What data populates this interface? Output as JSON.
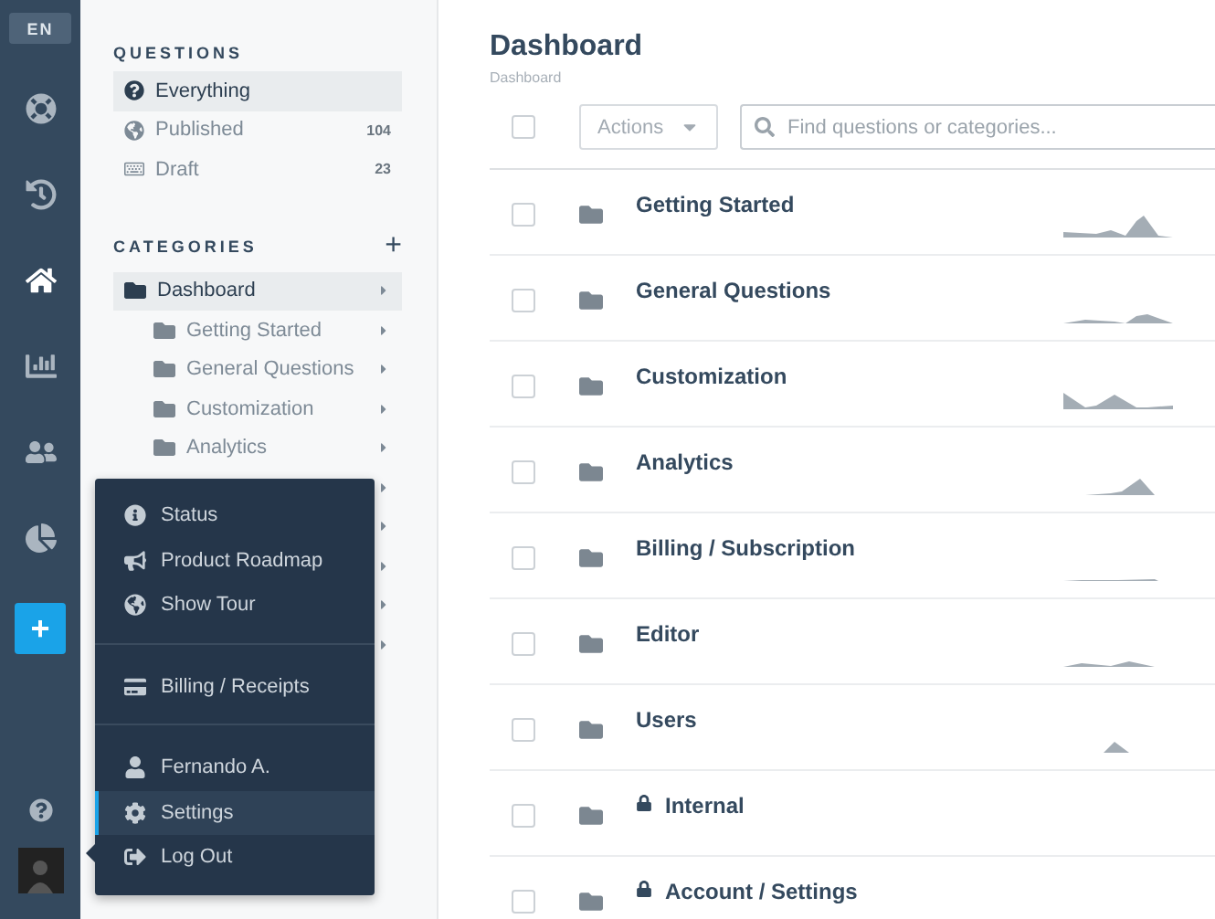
{
  "rail": {
    "language": "EN",
    "items": [
      {
        "selected": false
      },
      {
        "selected": false
      },
      {
        "selected": true
      },
      {
        "selected": false
      },
      {
        "selected": false
      },
      {
        "selected": false
      }
    ],
    "add_button": "+"
  },
  "sidebar": {
    "questions_heading": "QUESTIONS",
    "questions": [
      {
        "label": "Everything",
        "selected": true
      },
      {
        "label": "Published",
        "count": "104",
        "selected": false
      },
      {
        "label": "Draft",
        "count": "23",
        "selected": false
      }
    ],
    "categories_heading": "CATEGORIES",
    "add_category": "+",
    "categories": [
      {
        "label": "Dashboard",
        "selected": true,
        "children": [
          {
            "label": "Getting Started",
            "selected": false
          },
          {
            "label": "General Questions",
            "selected": false
          },
          {
            "label": "Customization",
            "selected": false
          },
          {
            "label": "Analytics",
            "selected": false
          }
        ]
      }
    ]
  },
  "menu": {
    "groups": [
      {
        "items": [
          {
            "label": "Status",
            "selected": false
          },
          {
            "label": "Product Roadmap",
            "selected": false
          },
          {
            "label": "Show Tour",
            "selected": false
          }
        ]
      },
      {
        "items": [
          {
            "label": "Billing / Receipts",
            "selected": false
          }
        ]
      },
      {
        "items": [
          {
            "label": "Fernando A.",
            "selected": false
          },
          {
            "label": "Settings",
            "selected": true
          },
          {
            "label": "Log Out",
            "selected": false
          }
        ]
      }
    ]
  },
  "main": {
    "title": "Dashboard",
    "breadcrumb": "Dashboard",
    "select_all_checked": false,
    "actions": "Actions",
    "search": {
      "placeholder": "Find questions or categories..."
    },
    "rows": [
      {
        "title": "Getting Started",
        "locked": false,
        "checked": false
      },
      {
        "title": "General Questions",
        "locked": false,
        "checked": false
      },
      {
        "title": "Customization",
        "locked": false,
        "checked": false
      },
      {
        "title": "Analytics",
        "locked": false,
        "checked": false
      },
      {
        "title": "Billing / Subscription",
        "locked": false,
        "checked": false
      },
      {
        "title": "Editor",
        "locked": false,
        "checked": false
      },
      {
        "title": "Users",
        "locked": false,
        "checked": false
      },
      {
        "title": "Internal",
        "locked": true,
        "checked": false
      },
      {
        "title": "Account / Settings",
        "locked": true,
        "checked": false
      }
    ]
  }
}
